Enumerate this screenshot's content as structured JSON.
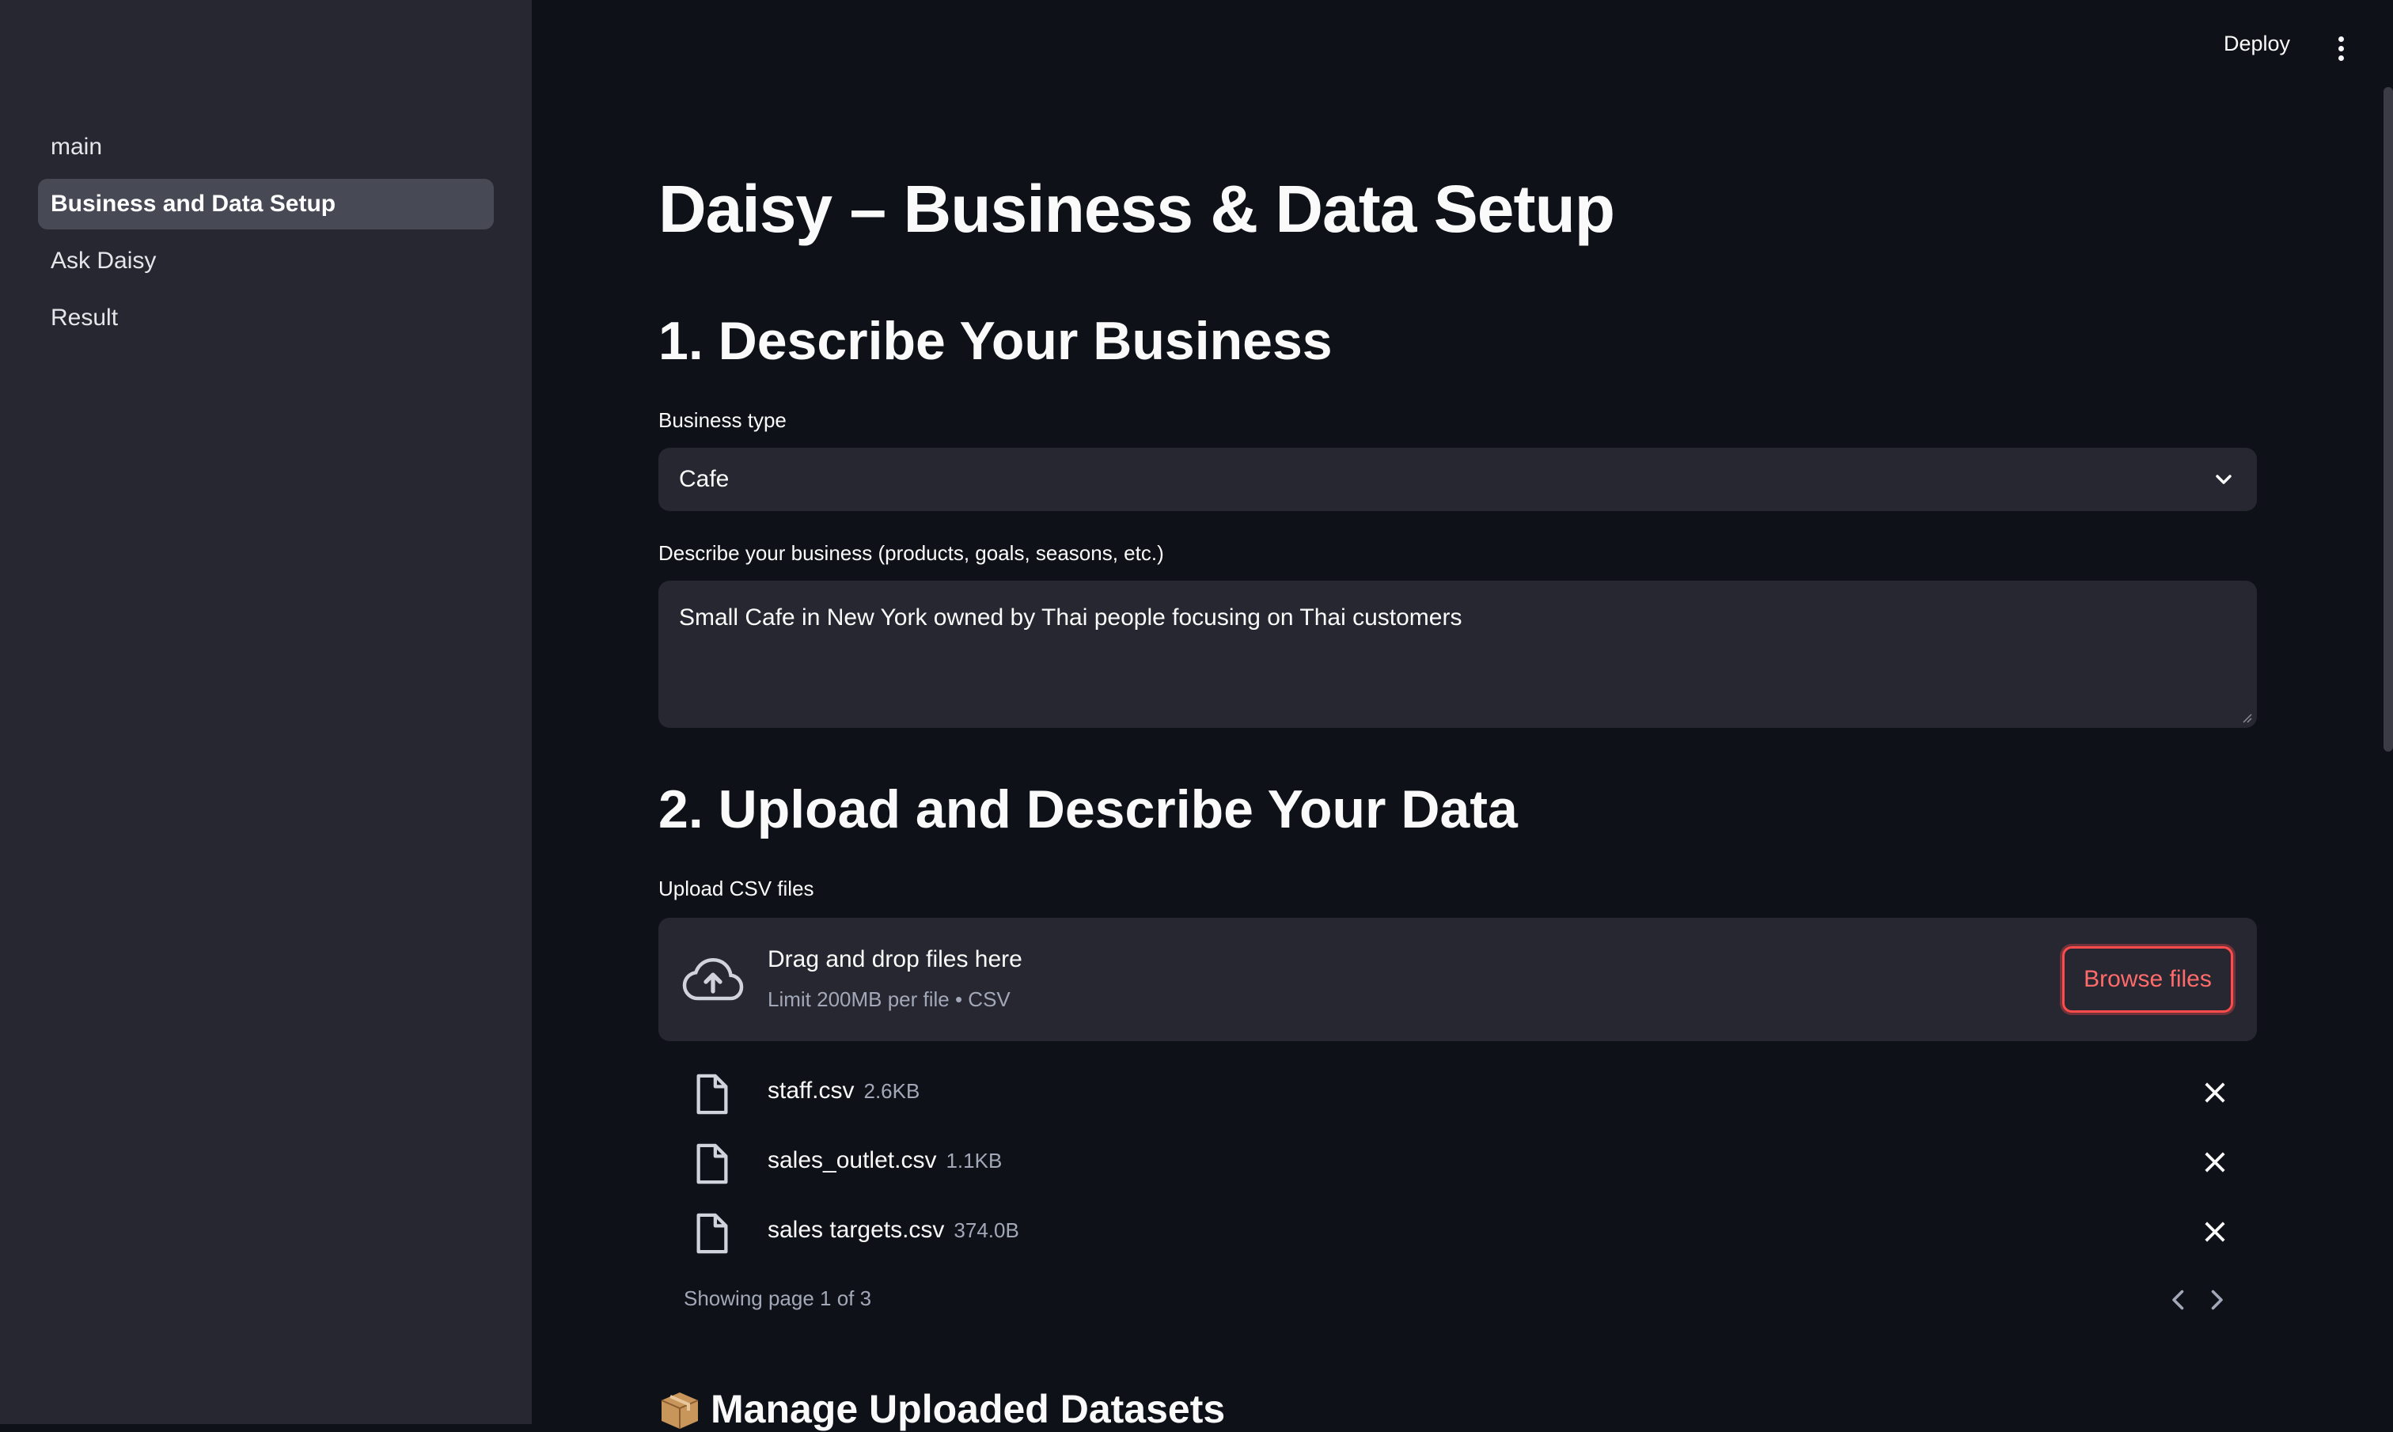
{
  "sidebar": {
    "items": [
      {
        "label": "main",
        "active": false
      },
      {
        "label": "Business and Data Setup",
        "active": true
      },
      {
        "label": "Ask Daisy",
        "active": false
      },
      {
        "label": "Result",
        "active": false
      }
    ]
  },
  "header": {
    "deploy_label": "Deploy",
    "menu_icon": "kebab-menu-icon"
  },
  "page": {
    "title": "Daisy – Business & Data Setup"
  },
  "section_business": {
    "heading": "1. Describe Your Business",
    "type_label": "Business type",
    "type_value": "Cafe",
    "description_label": "Describe your business (products, goals, seasons, etc.)",
    "description_value": "Small Cafe in New York owned by Thai people focusing on Thai customers"
  },
  "section_data": {
    "heading": "2. Upload and Describe Your Data",
    "upload_label": "Upload CSV files",
    "dropzone_title": "Drag and drop files here",
    "dropzone_subtitle": "Limit 200MB per file • CSV",
    "browse_label": "Browse files",
    "files": [
      {
        "name": "staff.csv",
        "size": "2.6KB"
      },
      {
        "name": "sales_outlet.csv",
        "size": "1.1KB"
      },
      {
        "name": "sales targets.csv",
        "size": "374.0B"
      }
    ],
    "pager_text": "Showing page 1 of 3"
  },
  "section_manage": {
    "heading": "Manage Uploaded Datasets",
    "icon": "package-icon"
  },
  "colors": {
    "background": "#0e1117",
    "sidebar": "#262730",
    "input": "#262730",
    "accent": "#ff4b4b"
  }
}
